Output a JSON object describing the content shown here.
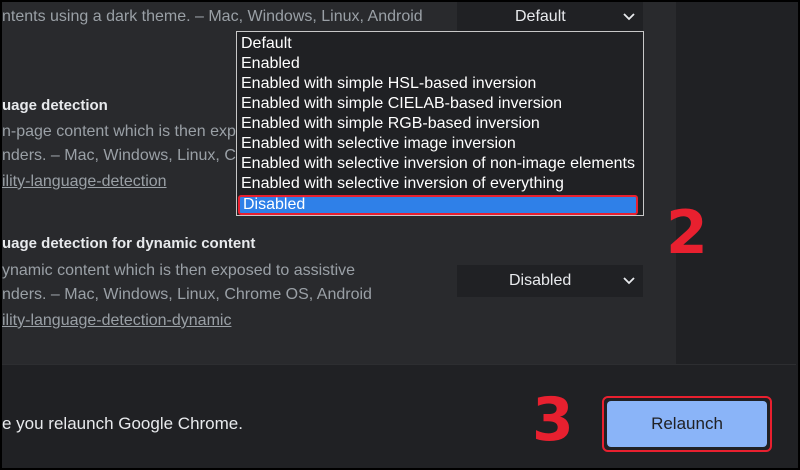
{
  "flag_dark_mode": {
    "description_line": "ntents using a dark theme. – Mac, Windows, Linux, Android",
    "select_value": "Default"
  },
  "dropdown": {
    "options": [
      "Default",
      "Enabled",
      "Enabled with simple HSL-based inversion",
      "Enabled with simple CIELAB-based inversion",
      "Enabled with simple RGB-based inversion",
      "Enabled with selective image inversion",
      "Enabled with selective inversion of non-image elements",
      "Enabled with selective inversion of everything",
      "Disabled"
    ],
    "selected": "Disabled"
  },
  "flag_language_detection": {
    "title": "uage detection",
    "description_line1": "n-page content which is then expo",
    "description_line2": "nders. – Mac, Windows, Linux, Ch",
    "link": "ility-language-detection"
  },
  "flag_language_detection_dynamic": {
    "title": "uage detection for dynamic content",
    "description_line1": "ynamic content which is then exposed to assistive",
    "description_line2": "nders. – Mac, Windows, Linux, Chrome OS, Android",
    "link": "ility-language-detection-dynamic",
    "select_value": "Disabled"
  },
  "footer": {
    "message": "e you relaunch Google Chrome.",
    "relaunch_label": "Relaunch"
  },
  "annotations": {
    "step2": "2",
    "step3": "3"
  },
  "colors": {
    "accent_blue": "#8ab4f8",
    "selection_blue": "#2f80e8",
    "annotation_red": "#e8202f",
    "page_bg": "#292a2d",
    "control_bg": "#202124"
  }
}
